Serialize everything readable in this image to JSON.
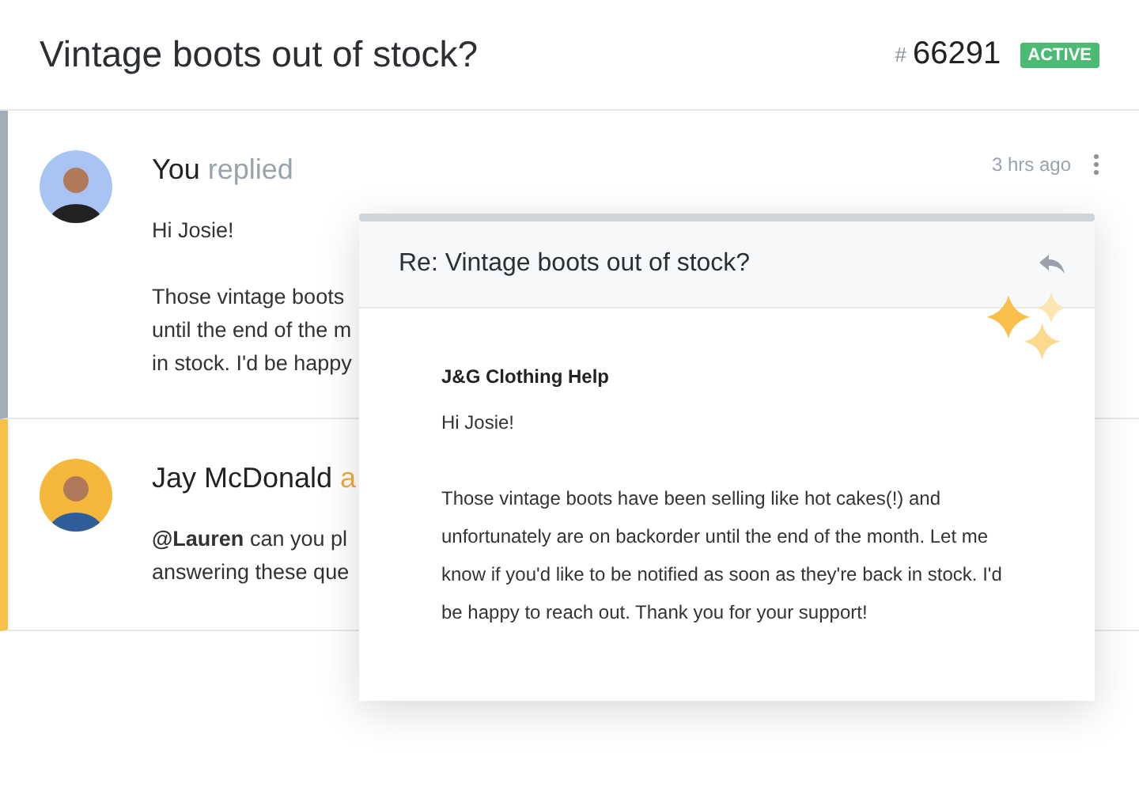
{
  "ticket": {
    "title": "Vintage boots out of stock?",
    "hash": "#",
    "number": "66291",
    "status": "ACTIVE"
  },
  "messages": [
    {
      "kind": "reply",
      "author": "You",
      "action": "replied",
      "time": "3 hrs ago",
      "paragraphs": [
        [
          "Hi Josie!"
        ],
        [
          "Those vintage boots",
          "until the end of the m",
          "in stock. I'd be happy"
        ]
      ]
    },
    {
      "kind": "note",
      "author": "Jay McDonald",
      "action": "a",
      "paragraphs": [
        [
          "**@Lauren** can you pl",
          "answering these que"
        ]
      ]
    }
  ],
  "email": {
    "subject": "Re: Vintage boots out of stock?",
    "from": "J&G Clothing Help",
    "greeting": "Hi Josie!",
    "body": "Those vintage boots have been selling like hot cakes(!) and unfortunately are on backorder until the end of the month. Let me know if you'd like to be notified as soon as they're back in stock. I'd be happy to reach out. Thank you for your support!"
  }
}
